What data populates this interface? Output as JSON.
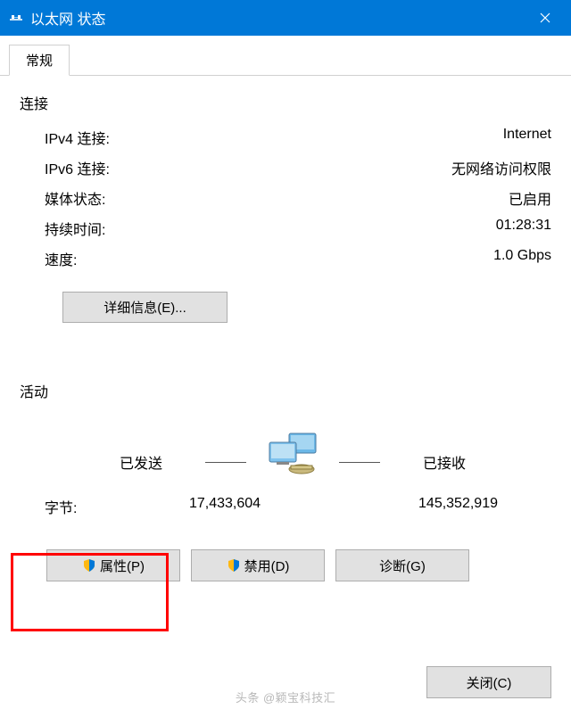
{
  "window": {
    "title": "以太网 状态",
    "tab_general": "常规"
  },
  "connection": {
    "section_label": "连接",
    "rows": {
      "ipv4_label": "IPv4 连接:",
      "ipv4_value": "Internet",
      "ipv6_label": "IPv6 连接:",
      "ipv6_value": "无网络访问权限",
      "media_label": "媒体状态:",
      "media_value": "已启用",
      "duration_label": "持续时间:",
      "duration_value": "01:28:31",
      "speed_label": "速度:",
      "speed_value": "1.0 Gbps"
    },
    "details_button": "详细信息(E)..."
  },
  "activity": {
    "section_label": "活动",
    "sent_label": "已发送",
    "received_label": "已接收",
    "bytes_label": "字节:",
    "bytes_sent": "17,433,604",
    "bytes_received": "145,352,919"
  },
  "buttons": {
    "properties": "属性(P)",
    "disable": "禁用(D)",
    "diagnose": "诊断(G)",
    "close": "关闭(C)"
  },
  "watermark": "头条 @颖宝科技汇"
}
